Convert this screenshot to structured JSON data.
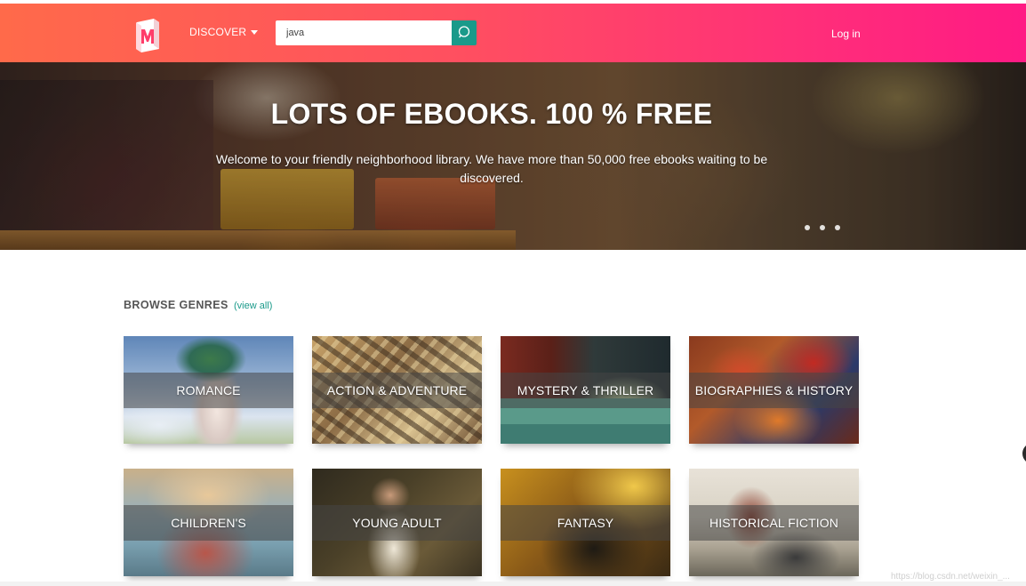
{
  "header": {
    "logo_icon": "manybooks-logo-icon",
    "discover_label": "DISCOVER",
    "search": {
      "value": "java",
      "placeholder": "",
      "button_icon": "search-icon"
    },
    "login_label": "Log in"
  },
  "hero": {
    "title": "LOTS OF EBOOKS. 100 % FREE",
    "subtitle": "Welcome to your friendly neighborhood library. We have more than 50,000 free ebooks waiting to be discovered.",
    "carousel_slide_count": 3
  },
  "genres": {
    "heading": "BROWSE GENRES",
    "view_all": "(view all)",
    "items": [
      {
        "label": "ROMANCE"
      },
      {
        "label": "ACTION & ADVENTURE"
      },
      {
        "label": "MYSTERY & THRILLER"
      },
      {
        "label": "BIOGRAPHIES & HISTORY"
      },
      {
        "label": "CHILDREN'S"
      },
      {
        "label": "YOUNG ADULT"
      },
      {
        "label": "FANTASY"
      },
      {
        "label": "HISTORICAL FICTION"
      }
    ]
  },
  "footer": {
    "watermark": "https://blog.csdn.net/weixin_..."
  },
  "colors": {
    "header_gradient_start": "#ff6a4a",
    "header_gradient_end": "#ff1a84",
    "search_button": "#1a9a8a",
    "link_accent": "#1a9a8a"
  }
}
